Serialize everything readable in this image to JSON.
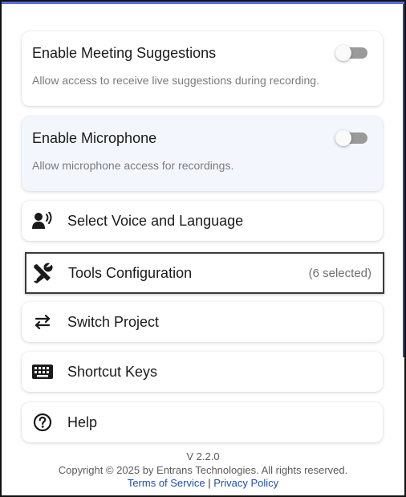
{
  "settings": {
    "meeting_suggestions": {
      "title": "Enable Meeting Suggestions",
      "description": "Allow access to receive live suggestions during recording.",
      "enabled": false
    },
    "microphone": {
      "title": "Enable Microphone",
      "description": "Allow microphone access for recordings.",
      "enabled": false
    }
  },
  "menu": {
    "voice": {
      "label": "Select Voice and Language",
      "icon": "voice-user-icon"
    },
    "tools": {
      "label": "Tools Configuration",
      "meta": "(6 selected)",
      "icon": "tools-icon"
    },
    "project": {
      "label": "Switch Project",
      "icon": "swap-arrows-icon"
    },
    "shortcuts": {
      "label": "Shortcut Keys",
      "icon": "keyboard-icon"
    },
    "help": {
      "label": "Help",
      "icon": "question-circle-icon"
    }
  },
  "footer": {
    "version": "V 2.2.0",
    "copyright": "Copyright © 2025 by Entrans Technologies. All rights reserved.",
    "terms": "Terms of Service",
    "separator": "|",
    "privacy": "Privacy Policy"
  },
  "colors": {
    "accent": "#5b6ee1",
    "link": "#1f4fb4",
    "toggle_off_track": "#9a9a9a",
    "tinted_card": "#f3f6fd"
  }
}
